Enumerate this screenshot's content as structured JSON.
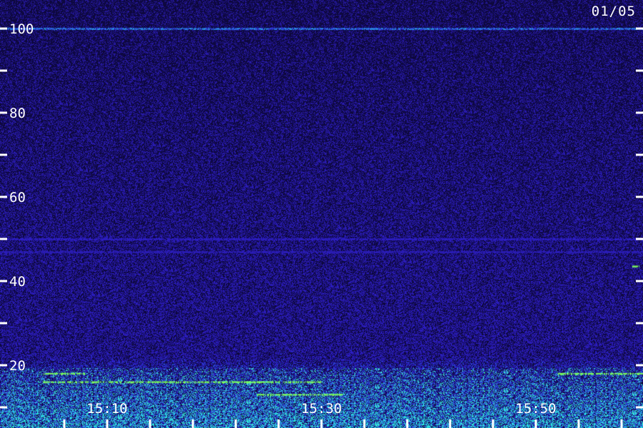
{
  "date": "01/05",
  "colors": {
    "background": "#160f44",
    "noise_low": "#2a1f8a",
    "noise_high": "#3a4bd8",
    "band": "#2fd4ff",
    "signal": "#7dff5a",
    "text": "#ffffff"
  },
  "chart_data": {
    "type": "heatmap",
    "title": "",
    "xlabel": "",
    "ylabel": "",
    "ylim": [
      13,
      107
    ],
    "y_ticks": [
      {
        "value": 100,
        "label": "100"
      },
      {
        "value": 90,
        "label": ""
      },
      {
        "value": 80,
        "label": "80"
      },
      {
        "value": 70,
        "label": ""
      },
      {
        "value": 60,
        "label": "60"
      },
      {
        "value": 50,
        "label": ""
      },
      {
        "value": 40,
        "label": "40"
      },
      {
        "value": 30,
        "label": ""
      },
      {
        "value": 20,
        "label": "20"
      },
      {
        "value": 10,
        "label": ""
      }
    ],
    "x_range": [
      "15:04",
      "16:01"
    ],
    "x_ticks": [
      {
        "time": "15:06",
        "label": ""
      },
      {
        "time": "15:10",
        "label": "15:10"
      },
      {
        "time": "15:14",
        "label": ""
      },
      {
        "time": "15:18",
        "label": ""
      },
      {
        "time": "15:22",
        "label": ""
      },
      {
        "time": "15:26",
        "label": ""
      },
      {
        "time": "15:30",
        "label": "15:30"
      },
      {
        "time": "15:34",
        "label": ""
      },
      {
        "time": "15:38",
        "label": ""
      },
      {
        "time": "15:42",
        "label": ""
      },
      {
        "time": "15:46",
        "label": ""
      },
      {
        "time": "15:50",
        "label": "15:50"
      },
      {
        "time": "15:54",
        "label": ""
      },
      {
        "time": "15:58",
        "label": ""
      }
    ],
    "bands": [
      {
        "y": 100,
        "color": "#2f6bff",
        "intensity": 0.8
      },
      {
        "y": 50,
        "color": "#2f5cf0",
        "intensity": 0.55
      },
      {
        "y": 47,
        "color": "#2f5cf0",
        "intensity": 0.45
      }
    ],
    "signals": [
      {
        "t_start": "15:04",
        "t_end": "15:08",
        "y": 18,
        "color": "#7dff5a"
      },
      {
        "t_start": "15:52",
        "t_end": "16:01",
        "y": 18,
        "color": "#7dff5a"
      },
      {
        "t_start": "15:04",
        "t_end": "15:30",
        "y": 16,
        "color": "#7dff5a"
      },
      {
        "t_start": "15:24",
        "t_end": "15:32",
        "y": 13,
        "color": "#7dff5a"
      },
      {
        "t_start": "15:59",
        "t_end": "15:59",
        "y": 43.5,
        "color": "#7dff5a"
      }
    ],
    "grid": false
  }
}
